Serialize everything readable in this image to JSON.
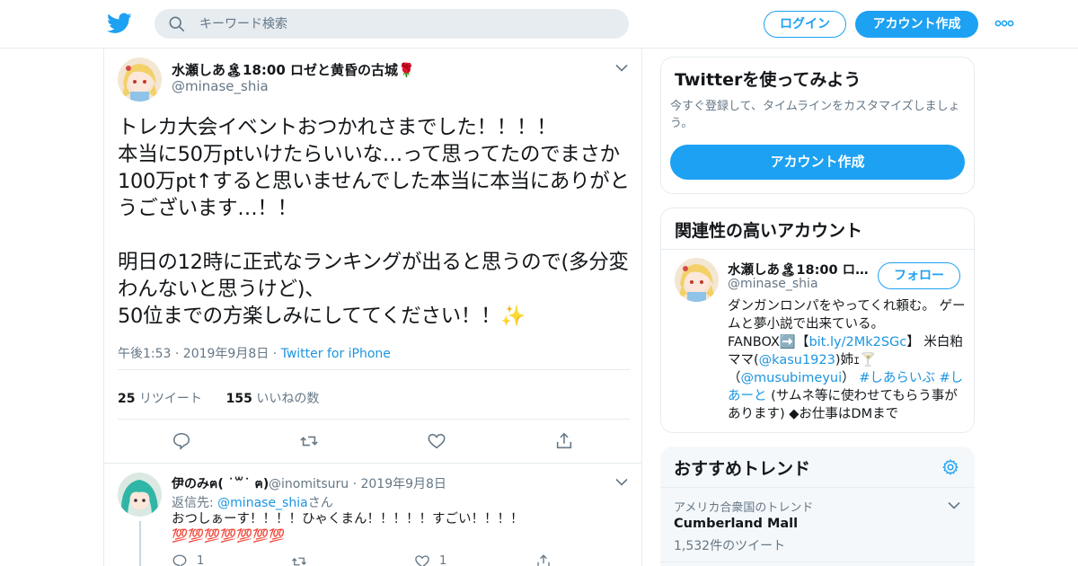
{
  "header": {
    "search_placeholder": "キーワード検索",
    "login_label": "ログイン",
    "signup_label": "アカウント作成"
  },
  "tweet": {
    "author_name": "水瀬しあ🏝18:00 ロゼと黄昏の古城🌹",
    "author_handle": "@minase_shia",
    "text": "トレカ大会イベントおつかれさまでした！！！！\n本当に50万ptいけたらいいな…って思ってたのでまさか100万pt↑すると思いませんでした本当に本当にありがとうございます…！！\n\n明日の12時に正式なランキングが出ると思うので(多分変わんないと思うけど)、\n50位までの方楽しみにしててください！！✨",
    "time": "午後1:53 · 2019年9月8日",
    "dot": "·",
    "source": "Twitter for iPhone",
    "retweet_count": "25",
    "retweet_label": "リツイート",
    "like_count": "155",
    "like_label": "いいねの数"
  },
  "reply": {
    "author_name": "伊のみฅ( ˙꒳˙ ฅ)",
    "author_handle": "@inomitsuru · 2019年9月8日",
    "reply_to_prefix": "返信先: ",
    "reply_to_handle": "@minase_shia",
    "reply_to_suffix": "さん",
    "text": "おつしぁーす！！！！ひゃくまん！！！！！すごい！！！！💯💯💯💯💯💯💯",
    "reply_count": "1",
    "like_count": "1"
  },
  "sidebar": {
    "signup_card": {
      "title": "Twitterを使ってみよう",
      "desc": "今すぐ登録して、タイムラインをカスタマイズしましょう。",
      "button": "アカウント作成"
    },
    "related": {
      "title": "関連性の高いアカウント",
      "name": "水瀬しあ🏝18:00 ロ…",
      "handle": "@minase_shia",
      "follow_label": "フォロー",
      "bio_1": "ダンガンロンパをやってくれ頼む。 ゲームと夢小説で出来ている。\nFANBOX➡️【",
      "bio_link1": "bit.ly/2Mk2SGc",
      "bio_2": "】 米白粕ママ(",
      "bio_link2": "@kasu1923",
      "bio_3": ")姉ｪ🍸\n（",
      "bio_link3": "@musubimeyui",
      "bio_4": "） ",
      "bio_link4": "#しあらいぶ #しあーと",
      "bio_5": " (サムネ等に使わせてもらう事があります) ◆お仕事はDMまで"
    },
    "trends": {
      "title": "おすすめトレンド",
      "items": [
        {
          "context": "アメリカ合衆国のトレンド",
          "name": "Cumberland Mall",
          "count": "1,532件のツイート"
        }
      ]
    }
  }
}
